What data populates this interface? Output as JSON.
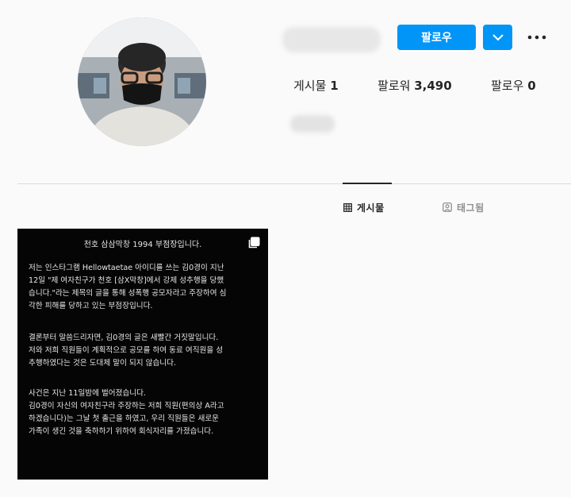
{
  "header": {
    "follow_label": "팔로우",
    "icons": {
      "dropdown": "chevron-down-icon",
      "more": "more-dots-icon"
    }
  },
  "stats": {
    "posts_label": "게시물",
    "posts_count": "1",
    "followers_label": "팔로워",
    "followers_count": "3,490",
    "following_label": "팔로우",
    "following_count": "0"
  },
  "tabs": [
    {
      "label": "게시물",
      "icon": "grid-icon",
      "active": true
    },
    {
      "label": "태그됨",
      "icon": "tag-person-icon",
      "active": false
    }
  ],
  "post": {
    "title": "천호 삼삼막창 1994 부점장입니다.",
    "paragraphs": [
      [
        "저는 인스타그램 Hellowtaetae 아이디를 쓰는 김0경이 지난",
        "12일 \"제 여자친구가 천호 [삼X막창]에서 강제 성추행을 당했",
        "습니다.\"라는 제목의 글을 통해 성폭행 공모자라고 주장하여 심",
        "각한 피해를 당하고 있는 부점장입니다."
      ],
      [
        "결론부터 말씀드리자면, 김0경의 글은 새빨간 거짓말입니다.",
        "저와 저희 직원들이 계획적으로 공모를 하여 동료 여직원을 성",
        "추행하였다는 것은 도대체 말이 되지 않습니다."
      ],
      [
        "사건은 지난 11일밤에 벌어졌습니다.",
        "김0경이 자신의 여자친구라 주장하는 저희 직원(편의상 A라고",
        "하겠습니다)는 그날 첫 출근을 하였고, 우리 직원들은 새로운",
        "가족이 생긴 것을 축하하기 위하여 회식자리를 가졌습니다."
      ]
    ]
  },
  "colors": {
    "accent": "#0095f6",
    "background": "#fafafa",
    "post_background": "#050505"
  }
}
